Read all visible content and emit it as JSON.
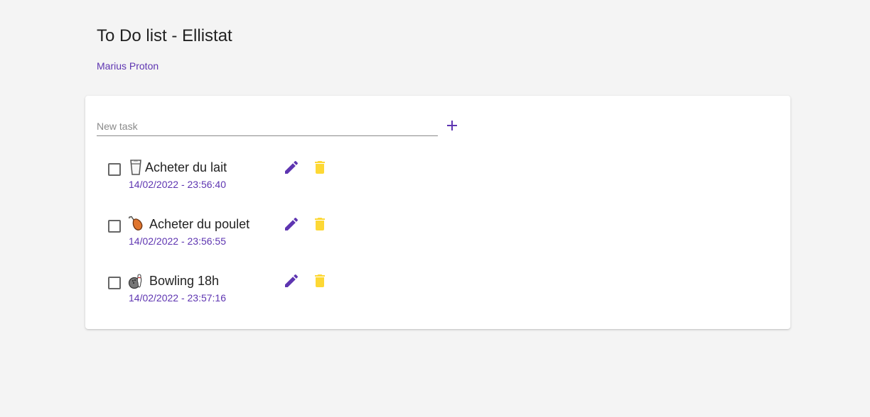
{
  "header": {
    "title": "To Do list - Ellistat",
    "author": "Marius Proton"
  },
  "new_task": {
    "placeholder": "New task",
    "value": ""
  },
  "icons": {
    "add": "plus-icon",
    "edit": "pencil-icon",
    "delete": "trash-icon"
  },
  "colors": {
    "accent": "#5e35b1",
    "delete": "#fdd835",
    "background": "#f4f4f4"
  },
  "tasks": [
    {
      "emoji": "glass-of-milk",
      "label": "Acheter du lait",
      "date": "14/02/2022 - 23:56:40",
      "done": false
    },
    {
      "emoji": "poultry-leg",
      "label": "Acheter du poulet",
      "date": "14/02/2022 - 23:56:55",
      "done": false
    },
    {
      "emoji": "bowling",
      "label": "Bowling 18h",
      "date": "14/02/2022 - 23:57:16",
      "done": false
    }
  ]
}
